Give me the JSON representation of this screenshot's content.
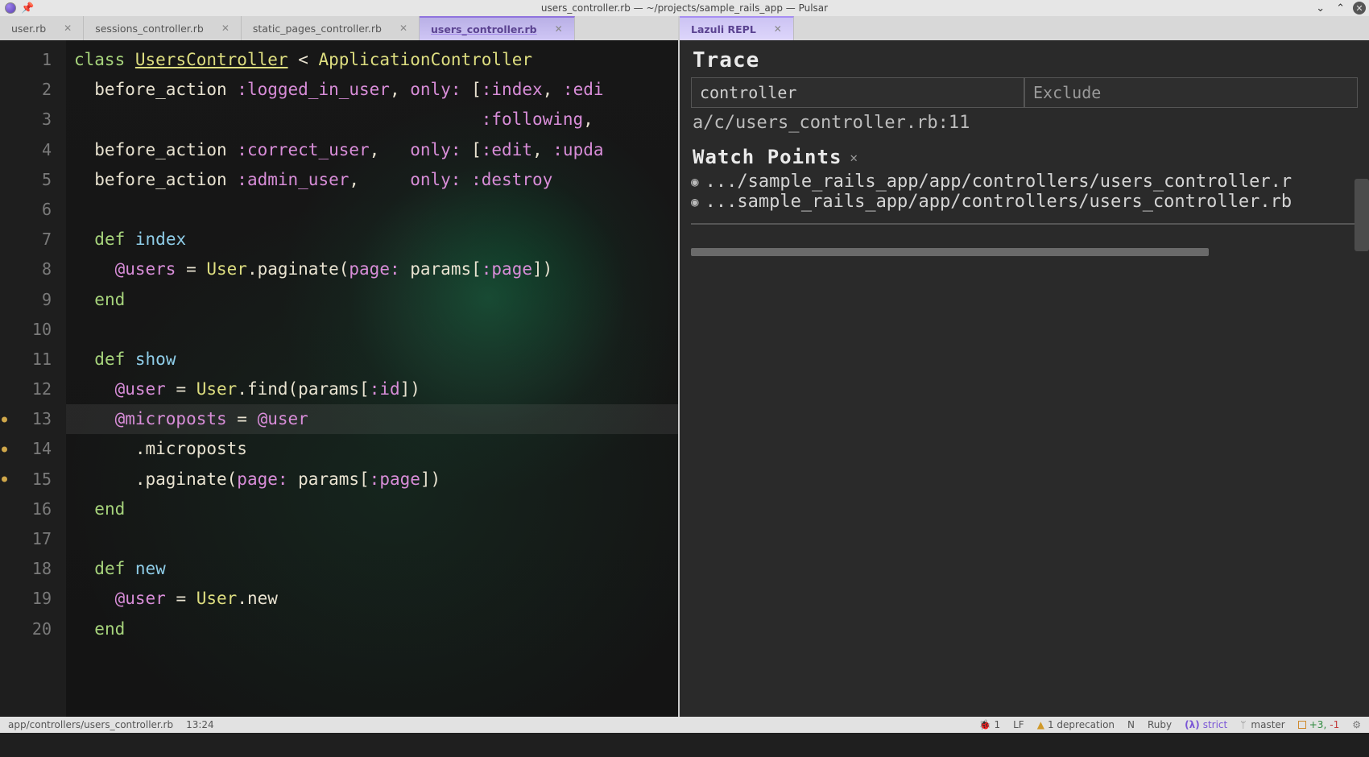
{
  "window": {
    "title": "users_controller.rb — ~/projects/sample_rails_app — Pulsar"
  },
  "left_tabs": [
    {
      "label": "user.rb",
      "active": false
    },
    {
      "label": "sessions_controller.rb",
      "active": false
    },
    {
      "label": "static_pages_controller.rb",
      "active": false
    },
    {
      "label": "users_controller.rb",
      "active": true
    }
  ],
  "right_tabs": [
    {
      "label": "Lazuli REPL",
      "active": true
    }
  ],
  "editor": {
    "cursor_line": 13,
    "modified_lines": [
      13,
      14,
      15
    ],
    "lines": [
      {
        "n": 1,
        "html": "<span class='tok-kw'>class</span> <span class='tok-cls'>UsersController</span> <span class='tok-op'>&lt;</span> <span class='tok-cls2'>ApplicationController</span>"
      },
      {
        "n": 2,
        "html": "  before_action <span class='tok-sym'>:logged_in_user</span>, <span class='tok-sym'>only:</span> [<span class='tok-sym'>:index</span>, <span class='tok-sym'>:edi</span>"
      },
      {
        "n": 3,
        "html": "                                        <span class='tok-sym'>:following</span>,"
      },
      {
        "n": 4,
        "html": "  before_action <span class='tok-sym'>:correct_user</span>,   <span class='tok-sym'>only:</span> [<span class='tok-sym'>:edit</span>, <span class='tok-sym'>:upda</span>"
      },
      {
        "n": 5,
        "html": "  before_action <span class='tok-sym'>:admin_user</span>,     <span class='tok-sym'>only:</span> <span class='tok-sym'>:destroy</span>"
      },
      {
        "n": 6,
        "html": ""
      },
      {
        "n": 7,
        "html": "  <span class='tok-kw'>def</span> <span class='tok-fn'>index</span>"
      },
      {
        "n": 8,
        "html": "    <span class='tok-sym'>@users</span> = <span class='tok-cls2'>User</span>.paginate(<span class='tok-sym'>page:</span> params[<span class='tok-sym'>:page</span>])"
      },
      {
        "n": 9,
        "html": "  <span class='tok-kw'>end</span>"
      },
      {
        "n": 10,
        "html": ""
      },
      {
        "n": 11,
        "html": "  <span class='tok-kw'>def</span> <span class='tok-fn'>show</span>"
      },
      {
        "n": 12,
        "html": "    <span class='tok-sym'>@user</span> = <span class='tok-cls2'>User</span>.find(params[<span class='tok-sym'>:id</span>])"
      },
      {
        "n": 13,
        "html": "    <span class='tok-sym'>@microposts</span> = <span class='tok-sym'>@user</span>"
      },
      {
        "n": 14,
        "html": "      .microposts"
      },
      {
        "n": 15,
        "html": "      .paginate(<span class='tok-sym'>page:</span> params[<span class='tok-sym'>:page</span>])"
      },
      {
        "n": 16,
        "html": "  <span class='tok-kw'>end</span>"
      },
      {
        "n": 17,
        "html": ""
      },
      {
        "n": 18,
        "html": "  <span class='tok-kw'>def</span> <span class='tok-fn'>new</span>"
      },
      {
        "n": 19,
        "html": "    <span class='tok-sym'>@user</span> = <span class='tok-cls2'>User</span>.new"
      },
      {
        "n": 20,
        "html": "  <span class='tok-kw'>end</span>"
      }
    ]
  },
  "repl": {
    "trace_heading": "Trace",
    "include_value": "controller",
    "exclude_placeholder": "Exclude",
    "matched_path": "a/c/users_controller.rb:11",
    "watch_heading": "Watch Points",
    "watch_points": [
      ".../sample_rails_app/app/controllers/users_controller.r",
      "...sample_rails_app/app/controllers/users_controller.rb"
    ]
  },
  "statusbar": {
    "path": "app/controllers/users_controller.rb",
    "cursor": "13:24",
    "error_count": "1",
    "line_ending": "LF",
    "deprecations": "1 deprecation",
    "mode_indicator": "N",
    "language": "Ruby",
    "strict_label": "strict",
    "branch": "master",
    "diff": "+3, -1"
  }
}
